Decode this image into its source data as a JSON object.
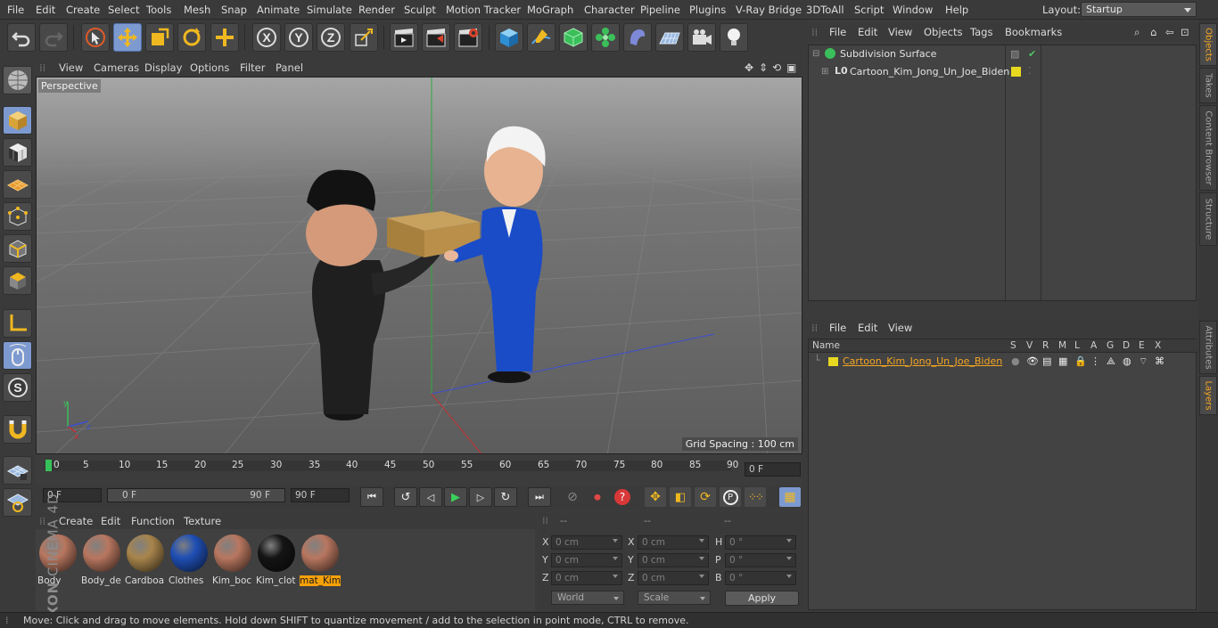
{
  "menubar": {
    "items": [
      "File",
      "Edit",
      "Create",
      "Select",
      "Tools",
      "Mesh",
      "Snap",
      "Animate",
      "Simulate",
      "Render",
      "Sculpt",
      "Motion Tracker",
      "MoGraph",
      "Character",
      "Pipeline",
      "Plugins",
      "V-Ray Bridge",
      "3DToAll",
      "Script",
      "Window",
      "Help"
    ],
    "layout_label": "Layout:",
    "layout_value": "Startup"
  },
  "toolbar": {
    "axis_x": "X",
    "axis_y": "Y",
    "axis_z": "Z"
  },
  "viewport": {
    "menu": [
      "View",
      "Cameras",
      "Display",
      "Options",
      "Filter",
      "Panel"
    ],
    "label": "Perspective",
    "grid_spacing": "Grid Spacing : 100 cm",
    "axis_labels": {
      "x": "x",
      "y": "y",
      "z": "z"
    }
  },
  "timeline": {
    "ticks": [
      "0",
      "5",
      "10",
      "15",
      "20",
      "25",
      "30",
      "35",
      "40",
      "45",
      "50",
      "55",
      "60",
      "65",
      "70",
      "75",
      "80",
      "85",
      "90"
    ],
    "current_frame": "0 F"
  },
  "animbar": {
    "start": "0 F",
    "range_start": "0 F",
    "range_end": "90 F",
    "end": "90 F"
  },
  "materials": {
    "menu": [
      "Create",
      "Edit",
      "Function",
      "Texture"
    ],
    "items": [
      {
        "label": "Body",
        "color": "#b87760"
      },
      {
        "label": "Body_de",
        "color": "#b87760"
      },
      {
        "label": "Cardboa",
        "color": "#a8854c"
      },
      {
        "label": "Clothes",
        "color": "#1f4fb5"
      },
      {
        "label": "Kim_boc",
        "color": "#b87760"
      },
      {
        "label": "Kim_clot",
        "color": "#151515"
      },
      {
        "label": "mat_Kim",
        "color": "#b87760"
      }
    ],
    "selected": "mat_Kim"
  },
  "coords": {
    "headers": [
      "--",
      "--",
      "--"
    ],
    "rows": [
      {
        "l1": "X",
        "v1": "0 cm",
        "l2": "X",
        "v2": "0 cm",
        "l3": "H",
        "v3": "0 °"
      },
      {
        "l1": "Y",
        "v1": "0 cm",
        "l2": "Y",
        "v2": "0 cm",
        "l3": "P",
        "v3": "0 °"
      },
      {
        "l1": "Z",
        "v1": "0 cm",
        "l2": "Z",
        "v2": "0 cm",
        "l3": "B",
        "v3": "0 °"
      }
    ],
    "world": "World",
    "scale": "Scale",
    "apply": "Apply"
  },
  "objects_panel": {
    "menu": [
      "File",
      "Edit",
      "View",
      "Objects",
      "Tags",
      "Bookmarks"
    ],
    "rows": [
      "Subdivision Surface",
      "Cartoon_Kim_Jong_Un_Joe_Biden"
    ]
  },
  "layers_panel": {
    "menu": [
      "File",
      "Edit",
      "View"
    ],
    "columns": [
      "Name",
      "S",
      "V",
      "R",
      "M",
      "L",
      "A",
      "G",
      "D",
      "E",
      "X"
    ],
    "rows": [
      "Cartoon_Kim_Jong_Un_Joe_Biden"
    ],
    "layer_color": "#e8d820"
  },
  "side_tabs": [
    "Objects",
    "Takes",
    "Content Browser",
    "Structure"
  ],
  "side_tabs_bottom": [
    "Attributes",
    "Layers"
  ],
  "brand": {
    "line1": "MAXON",
    "line2": "CINEMA 4D"
  },
  "status": "Move: Click and drag to move elements. Hold down SHIFT to quantize movement / add to the selection in point mode, CTRL to remove."
}
